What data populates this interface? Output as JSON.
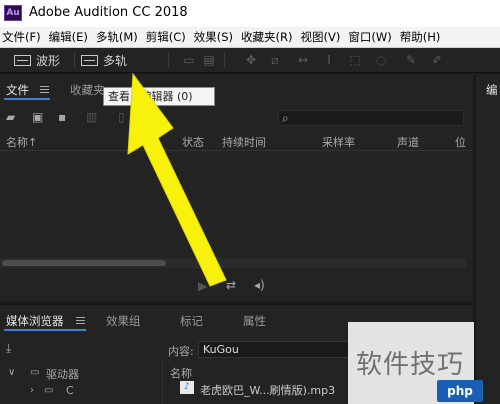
{
  "titlebar": {
    "app_icon_text": "Au",
    "title": "Adobe Audition CC 2018"
  },
  "menubar": {
    "items": [
      "文件(F)",
      "编辑(E)",
      "多轨(M)",
      "剪辑(C)",
      "效果(S)",
      "收藏夹(R)",
      "视图(V)",
      "窗口(W)",
      "帮助(H)"
    ]
  },
  "toolbar": {
    "waveform_label": "波形",
    "multitrack_label": "多轨"
  },
  "files_panel": {
    "tabs": [
      {
        "label": "文件",
        "active": true
      },
      {
        "label": "收藏夹",
        "active": false
      }
    ],
    "columns": [
      "名称",
      "状态",
      "持续时间",
      "采样率",
      "声道",
      "位"
    ],
    "name_sort_glyph": "↑",
    "search_icon": "⌕"
  },
  "tooltip": {
    "text": "查看...编辑器 (0)"
  },
  "right_panel": {
    "tab_label": "编"
  },
  "media_panel": {
    "tabs": [
      {
        "label": "媒体浏览器",
        "active": true
      },
      {
        "label": "效果组",
        "active": false
      },
      {
        "label": "标记",
        "active": false
      },
      {
        "label": "属性",
        "active": false
      }
    ],
    "content_label": "内容:",
    "content_value": "KuGou",
    "tree_root_label": "驱动器",
    "tree_child_label": "C",
    "list_header": "名称",
    "file_name": "老虎欧巴_W...刷情版).mp3"
  },
  "watermark": {
    "text": "软件技巧",
    "logo_text": "php"
  },
  "colors": {
    "accent": "#3a82d8",
    "arrow": "#f7f10c",
    "panel_bg": "#232323",
    "background": "#1e1e1e"
  },
  "icons": [
    "audition-app-icon",
    "waveform-icon",
    "multitrack-icon",
    "folder-open-icon",
    "import-icon",
    "new-file-icon",
    "save-icon",
    "delete-icon",
    "search-icon",
    "play-icon",
    "loop-icon",
    "volume-icon",
    "download-icon",
    "chevron-right-icon",
    "chevron-down-icon",
    "drive-icon",
    "audio-file-icon"
  ]
}
